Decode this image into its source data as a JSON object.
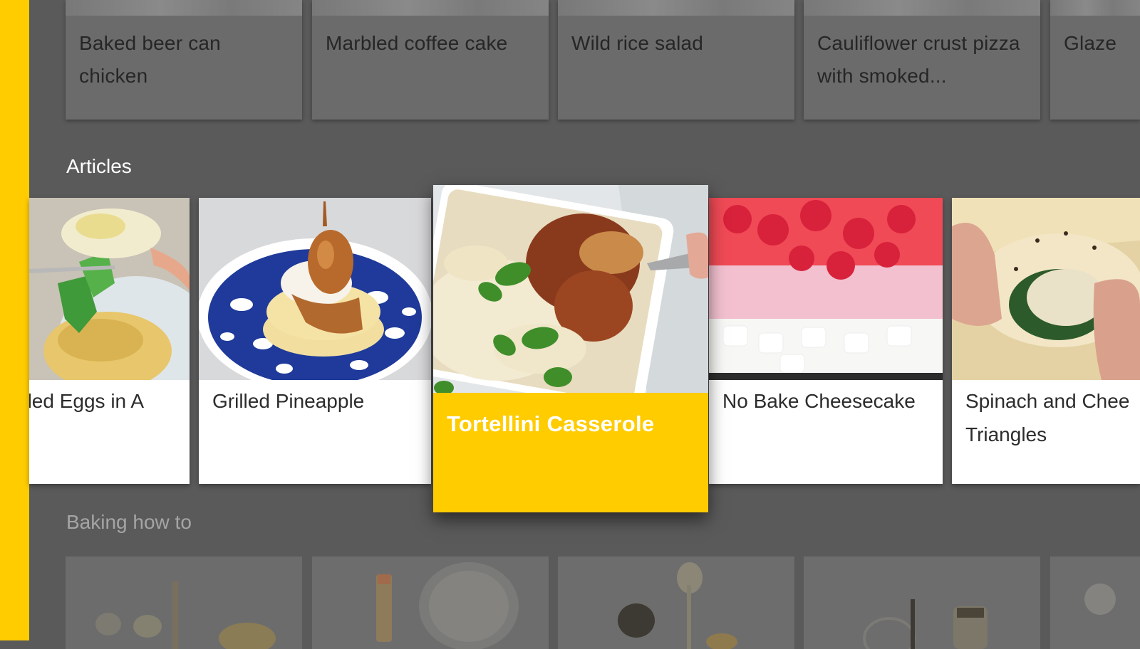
{
  "recipes_row": {
    "items": [
      {
        "title": "Baked beer can chicken"
      },
      {
        "title": "Marbled coffee cake"
      },
      {
        "title": "Wild rice salad"
      },
      {
        "title": "Cauliflower crust pizza with smoked..."
      },
      {
        "title": "Glaze"
      }
    ]
  },
  "articles": {
    "title": "Articles",
    "items": [
      {
        "title": "bled Eggs in A",
        "icon": "article-image"
      },
      {
        "title": "Grilled Pineapple",
        "icon": "article-image"
      },
      {
        "title": "Tortellini Casserole",
        "icon": "article-image",
        "focused": true
      },
      {
        "title": "No Bake Cheesecake",
        "icon": "article-image"
      },
      {
        "title": "Spinach and Chee Triangles",
        "icon": "article-image"
      }
    ]
  },
  "baking": {
    "title": "Baking how to"
  },
  "colors": {
    "accent": "#ffcc00",
    "background": "#5a5a5a",
    "card": "#ffffff"
  }
}
